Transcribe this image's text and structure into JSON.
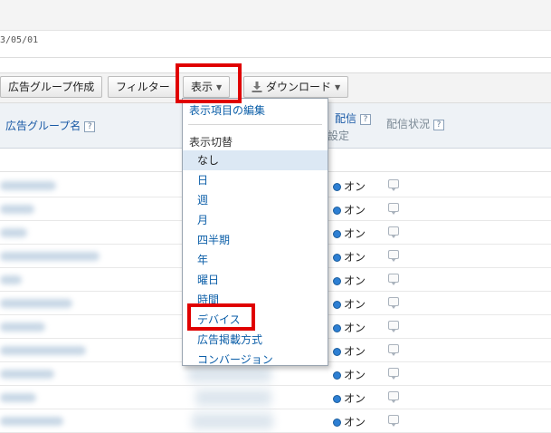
{
  "date_fragment": "3/05/01",
  "toolbar": {
    "ad_group_create": "広告グループ作成",
    "filter": "フィルター",
    "display": "表示",
    "download": "ダウンロード"
  },
  "table": {
    "col_name": "広告グループ名",
    "col_delivery_top": "配信",
    "col_delivery_bottom": "設定",
    "col_delivery_status": "配信状況",
    "help": "?",
    "rows": [
      {
        "status": "オン"
      },
      {
        "status": "オン"
      },
      {
        "status": "オン"
      },
      {
        "status": "オン"
      },
      {
        "status": "オン"
      },
      {
        "status": "オン"
      },
      {
        "status": "オン"
      },
      {
        "status": "オン"
      },
      {
        "status": "オン"
      },
      {
        "status": "オン"
      },
      {
        "status": "オン"
      }
    ]
  },
  "menu": {
    "edit_items": "表示項目の編集",
    "section": "表示切替",
    "items": [
      "なし",
      "日",
      "週",
      "月",
      "四半期",
      "年",
      "曜日",
      "時間",
      "デバイス",
      "広告掲載方式",
      "コンバージョン"
    ],
    "selected": "なし"
  },
  "colors": {
    "link": "#0b5ea8",
    "highlight": "#e00000",
    "selected_bg": "#dce8f4"
  }
}
